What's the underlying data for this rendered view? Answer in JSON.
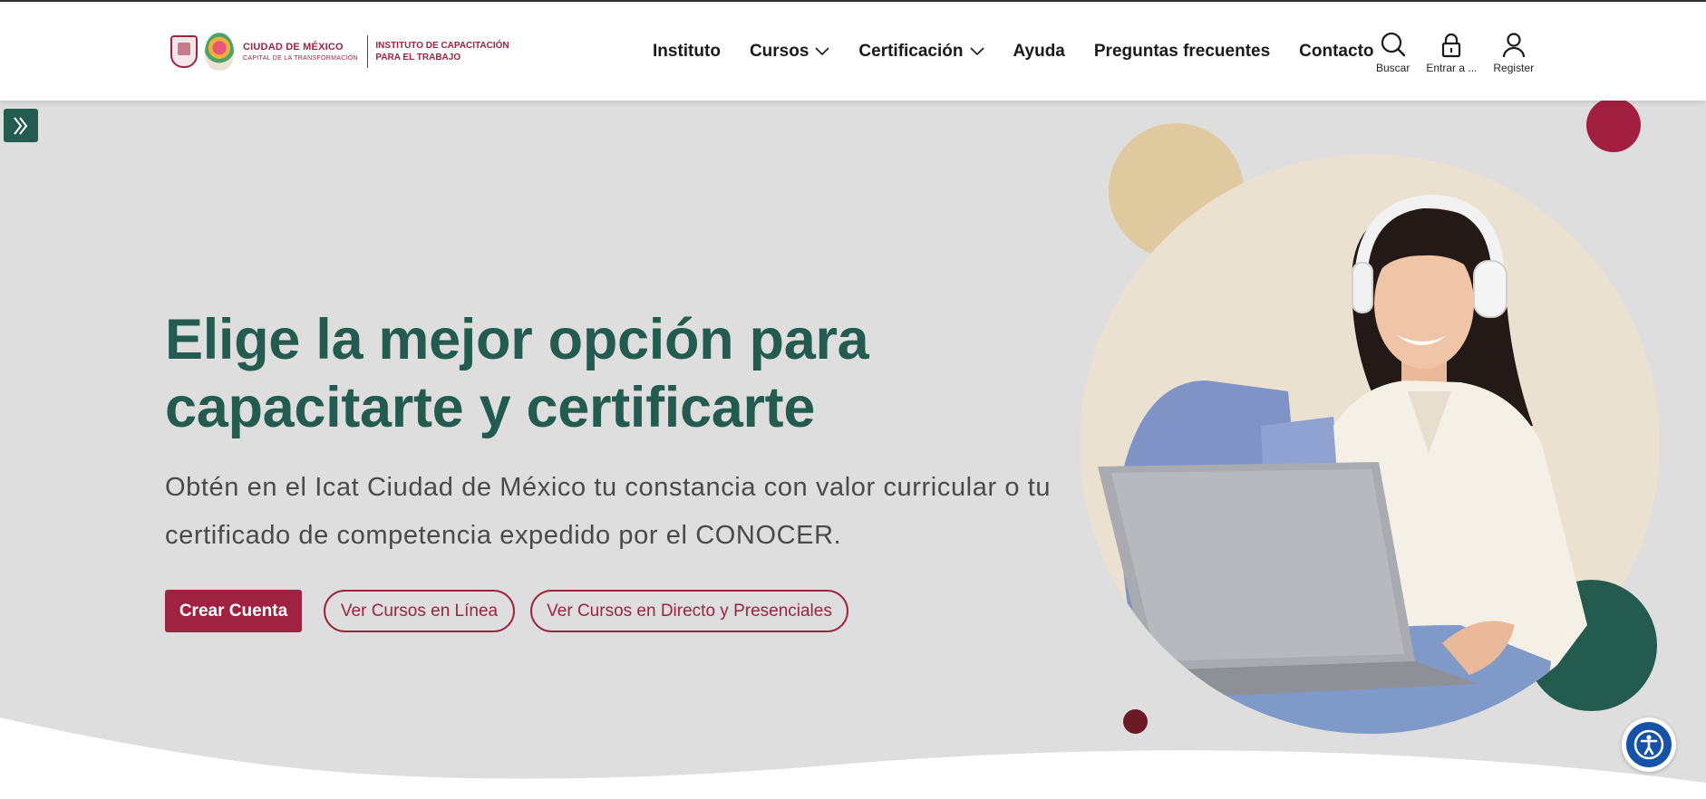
{
  "header": {
    "logo": {
      "city_name": "CIUDAD DE MÉXICO",
      "city_tagline": "CAPITAL DE LA TRANSFORMACIÓN",
      "institute_line1": "INSTITUTO DE CAPACITACIÓN",
      "institute_line2": "PARA EL TRABAJO"
    },
    "nav": [
      {
        "label": "Instituto",
        "has_dropdown": false
      },
      {
        "label": "Cursos",
        "has_dropdown": true
      },
      {
        "label": "Certificación",
        "has_dropdown": true
      },
      {
        "label": "Ayuda",
        "has_dropdown": false
      },
      {
        "label": "Preguntas frecuentes",
        "has_dropdown": false
      },
      {
        "label": "Contacto",
        "has_dropdown": false
      }
    ],
    "actions": {
      "search": {
        "label": "Buscar",
        "icon": "search-icon"
      },
      "login": {
        "label": "Entrar a ...",
        "icon": "lock-icon"
      },
      "register": {
        "label": "Register",
        "icon": "user-icon"
      }
    }
  },
  "hero": {
    "headline_line1": "Elige la mejor opción para",
    "headline_line2": "capacitarte y certificarte",
    "lead": "Obtén en el Icat Ciudad de México tu constancia con valor curricular o tu certificado de competencia expedido por el CONOCER.",
    "buttons": {
      "create_account": "Crear Cuenta",
      "online_courses": "Ver Cursos en Línea",
      "live_courses": "Ver Cursos en Directo y Presenciales"
    }
  },
  "icons": {
    "sidebar_toggle": "double-chevron-right-icon",
    "accessibility": "accessibility-icon"
  },
  "colors": {
    "brand_green": "#235b4e",
    "brand_red": "#9f2241",
    "tan": "#dfc99f",
    "cream": "#ebe1d1",
    "hero_bg": "#dedede",
    "accessibility_blue": "#1653a8"
  }
}
